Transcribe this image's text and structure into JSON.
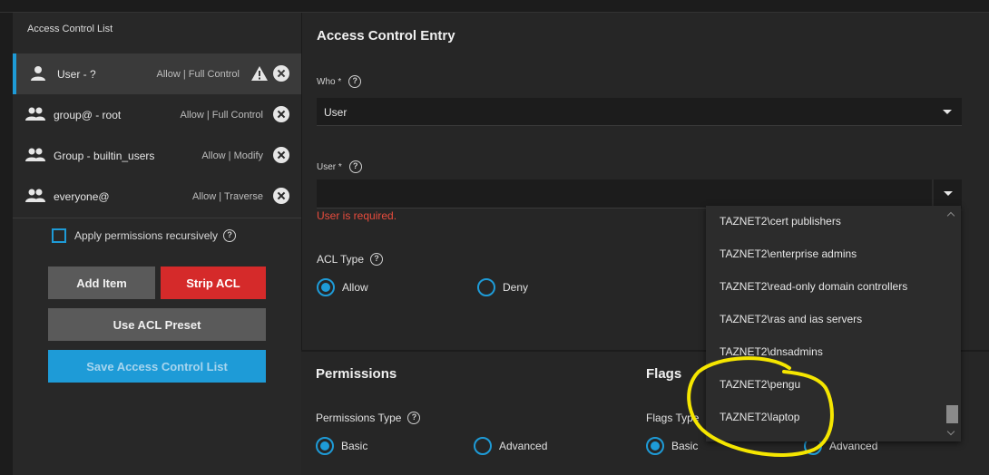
{
  "acl": {
    "title": "Access Control List",
    "entries": [
      {
        "name": "User - ?",
        "perm": "Allow | Full Control"
      },
      {
        "name": "group@ - root",
        "perm": "Allow | Full Control"
      },
      {
        "name": "Group - builtin_users",
        "perm": "Allow | Modify"
      },
      {
        "name": "everyone@",
        "perm": "Allow | Traverse"
      }
    ],
    "recursive_label": "Apply permissions recursively",
    "buttons": {
      "add": "Add Item",
      "strip": "Strip ACL",
      "preset": "Use ACL Preset",
      "save": "Save Access Control List"
    }
  },
  "entry": {
    "title": "Access Control Entry",
    "who_label": "Who *",
    "who_value": "User",
    "user_label": "User *",
    "user_error": "User is required.",
    "acl_type_label": "ACL Type",
    "acl_type_options": [
      "Allow",
      "Deny"
    ]
  },
  "permissions": {
    "title": "Permissions",
    "type_label": "Permissions Type",
    "options": [
      "Basic",
      "Advanced"
    ]
  },
  "flags": {
    "title": "Flags",
    "type_label": "Flags Type",
    "options": [
      "Basic",
      "Advanced"
    ]
  },
  "user_dropdown": {
    "items": [
      "TAZNET2\\cert publishers",
      "TAZNET2\\enterprise admins",
      "TAZNET2\\read-only domain controllers",
      "TAZNET2\\ras and ias servers",
      "TAZNET2\\dnsadmins",
      "TAZNET2\\pengu",
      "TAZNET2\\laptop"
    ]
  },
  "colors": {
    "accent": "#1e9bd7",
    "danger": "#d52a2a",
    "error_text": "#e84c3d",
    "annotation": "#f5e600"
  },
  "icons": {
    "user": "person-icon",
    "group": "group-icon",
    "warning": "warning-icon",
    "remove": "close-circle-icon",
    "help": "help-circle-icon",
    "dropdown": "chevron-down-icon"
  }
}
